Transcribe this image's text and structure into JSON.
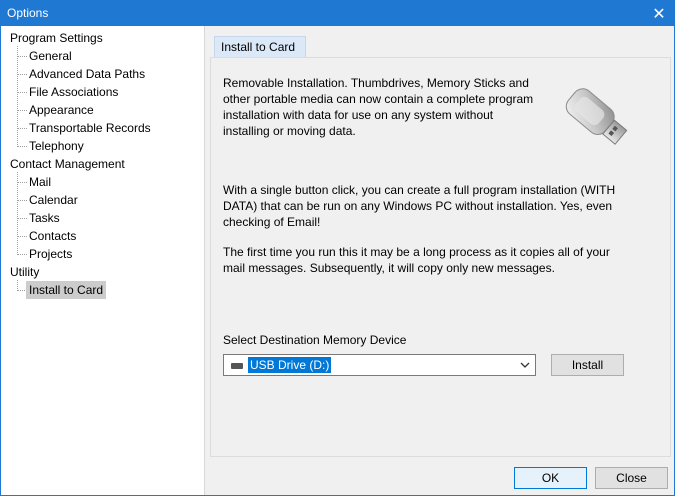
{
  "window": {
    "title": "Options"
  },
  "tree": {
    "groups": [
      {
        "label": "Program Settings",
        "items": [
          "General",
          "Advanced Data Paths",
          "File Associations",
          "Appearance",
          "Transportable Records",
          "Telephony"
        ]
      },
      {
        "label": "Contact Management",
        "items": [
          "Mail",
          "Calendar",
          "Tasks",
          "Contacts",
          "Projects"
        ]
      },
      {
        "label": "Utility",
        "items": [
          "Install to Card"
        ]
      }
    ],
    "selected": "Install to Card"
  },
  "tab": {
    "label": "Install to Card"
  },
  "content": {
    "para1": [
      "Removable Installation.  Thumbdrives, Memory Sticks and",
      "other portable media can now contain a complete program",
      "installation with data for use on any system without",
      "installing or moving data."
    ],
    "para2": [
      "With a single button click,  you can create a full program installation (WITH",
      "DATA) that can be run on any Windows PC without installation.  Yes, even",
      "checking of Email!"
    ],
    "para3": [
      "The first time you run this it may be a long process as it copies all of your",
      "mail messages.  Subsequently, it will copy only new messages."
    ],
    "dest_label": "Select Destination Memory Device",
    "device_selected": "USB Drive (D:)",
    "install_label": "Install"
  },
  "footer": {
    "ok_label": "OK",
    "close_label": "Close"
  },
  "icons": {
    "close": "close-icon",
    "usb": "usb-drive-icon",
    "chevron": "chevron-down-icon"
  },
  "colors": {
    "titlebar": "#1f78d1",
    "selection": "#0078d7",
    "tab": "#dbe8f7"
  }
}
